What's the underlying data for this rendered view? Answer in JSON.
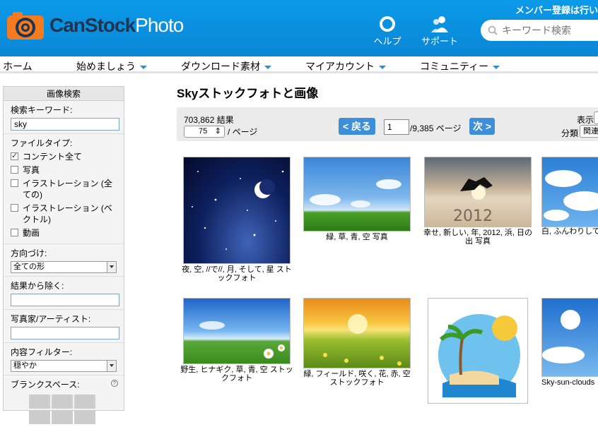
{
  "header": {
    "logo_main": "CanStock",
    "logo_photo": "Photo",
    "member_link": "メンバー登録は行い",
    "help_label": "ヘルプ",
    "support_label": "サポート",
    "search_placeholder": "キーワード検索"
  },
  "nav": {
    "items": [
      "ホーム",
      "始めましょう",
      "ダウンロード素材",
      "マイアカウント",
      "コミュニティー"
    ]
  },
  "sidebar": {
    "title": "画像検索",
    "keyword_label": "検索キーワード:",
    "keyword_value": "sky",
    "filetype_label": "ファイルタイプ:",
    "filetypes": [
      {
        "label": "コンテント全て",
        "checked": true
      },
      {
        "label": "写真",
        "checked": false
      },
      {
        "label": "イラストレーション (全ての)",
        "checked": false
      },
      {
        "label": "イラストレーション (ベクトル)",
        "checked": false
      },
      {
        "label": "動画",
        "checked": false
      }
    ],
    "orientation_label": "方向づけ:",
    "orientation_value": "全ての形",
    "exclude_label": "結果から除く:",
    "artist_label": "写真家/アーティスト:",
    "content_filter_label": "内容フィルター:",
    "content_filter_value": "穏やか",
    "blank_space_label": "ブランクスペース:",
    "help_glyph": "?"
  },
  "main": {
    "title": "Skyストックフォトと画像",
    "result_count": "703,862 結果",
    "per_page_value": "75",
    "per_page_suffix": "/ ページ",
    "prev_label": "< 戻る",
    "page_value": "1",
    "page_total": "/9,385 ページ",
    "next_label": "次 >",
    "display_label": "表示",
    "sort_label": "分類",
    "sort_value": "関連"
  },
  "thumbnails": [
    {
      "caption": "夜, 空, //で//, 月, そして, 星 ストックフォト"
    },
    {
      "caption": "緑, 草, 青, 空 写真"
    },
    {
      "caption": "幸せ, 新しい, 年, 2012, 浜, 日の出 写真",
      "img_text": "2012"
    },
    {
      "caption": "白, ふんわりしている, 背景, 雲"
    },
    {
      "caption": "野生, ヒナギク, 草, 青, 空 ストックフォト"
    },
    {
      "caption": "緑, フィールド, 咲く, 花, 赤, 空 ストックフォト"
    },
    {
      "caption": ""
    },
    {
      "caption": "Sky-sun-clouds"
    }
  ],
  "colors": {
    "header_blue": "#0a9ae8",
    "logo_orange": "#f47b20",
    "button_blue": "#3d8fd9",
    "nav_caret": "#1a8ee0"
  }
}
